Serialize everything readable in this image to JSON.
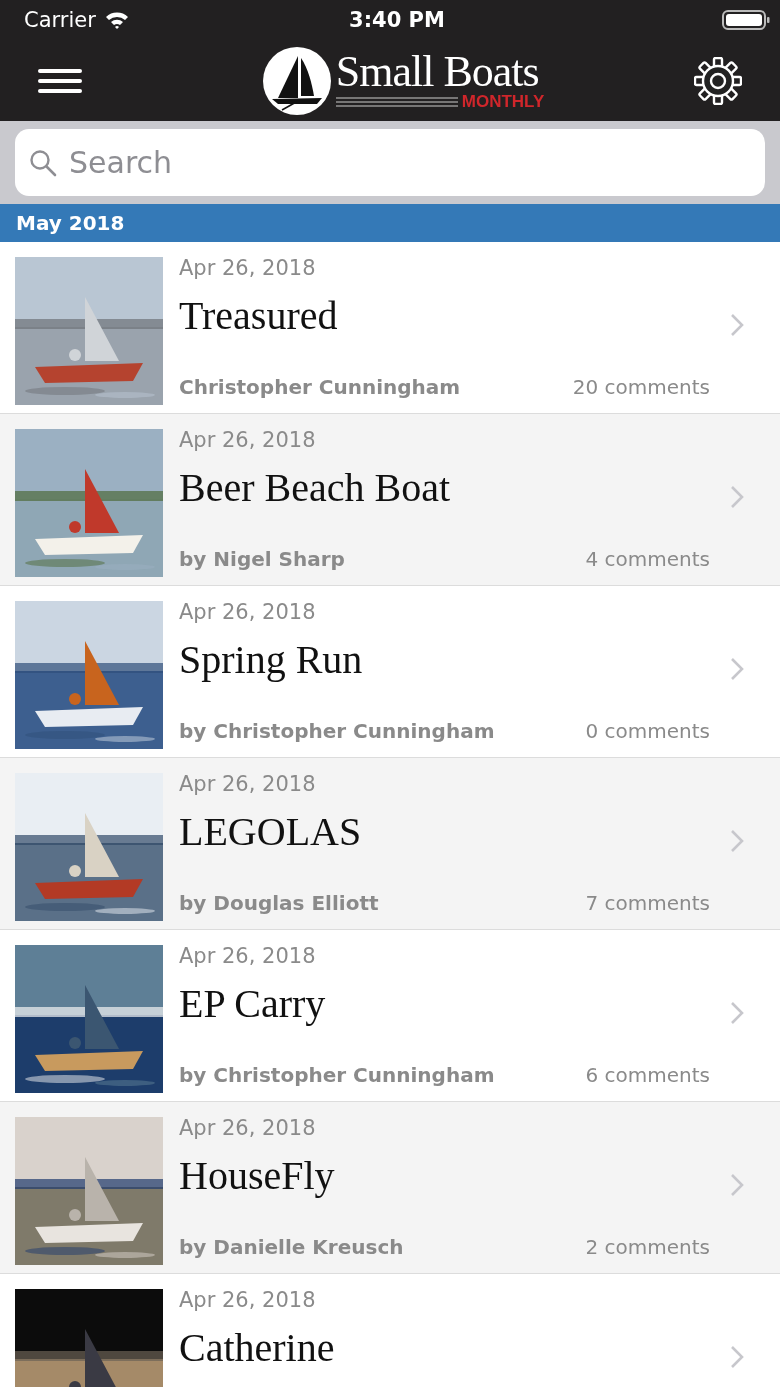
{
  "status_bar": {
    "carrier": "Carrier",
    "time": "3:40 PM"
  },
  "nav_bar": {
    "logo_title": "Small Boats",
    "logo_subtitle": "MONTHLY"
  },
  "search": {
    "placeholder": "Search"
  },
  "section": {
    "title": "May 2018"
  },
  "articles": [
    {
      "date": "Apr 26, 2018",
      "title": "Treasured",
      "author": "Christopher Cunningham",
      "comments": "20 comments"
    },
    {
      "date": "Apr 26, 2018",
      "title": "Beer Beach Boat",
      "author": "by Nigel Sharp",
      "comments": "4 comments"
    },
    {
      "date": "Apr 26, 2018",
      "title": "Spring Run",
      "author": "by Christopher Cunningham",
      "comments": "0 comments"
    },
    {
      "date": "Apr 26, 2018",
      "title": "LEGOLAS",
      "author": "by Douglas Elliott",
      "comments": "7 comments"
    },
    {
      "date": "Apr 26, 2018",
      "title": "EP Carry",
      "author": "by Christopher Cunningham",
      "comments": "6 comments"
    },
    {
      "date": "Apr 26, 2018",
      "title": "HouseFly",
      "author": "by Danielle Kreusch",
      "comments": "2 comments"
    },
    {
      "date": "Apr 26, 2018",
      "title": "Catherine"
    }
  ]
}
